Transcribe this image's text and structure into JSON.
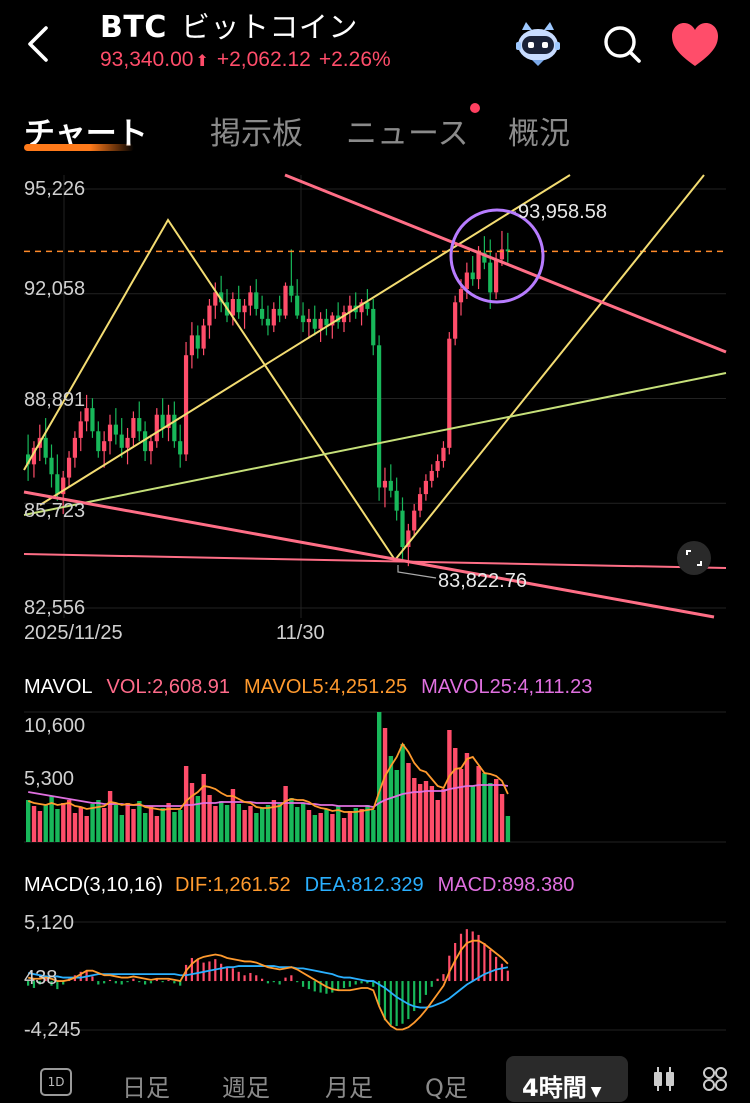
{
  "header": {
    "symbol": "BTC",
    "name": "ビットコイン",
    "price": "93,340.00",
    "change": "+2,062.12",
    "change_pct": "+2.26%"
  },
  "tabs": [
    {
      "label": "チャート",
      "active": true
    },
    {
      "label": "掲示板"
    },
    {
      "label": "ニュース",
      "has_dot": true
    },
    {
      "label": "概況"
    }
  ],
  "chart_data": [
    {
      "type": "candlestick",
      "ylim": [
        82556,
        95226
      ],
      "y_ticks": [
        "95,226",
        "92,058",
        "88,891",
        "85,723",
        "82,556"
      ],
      "x_ticks": [
        "2025/11/25",
        "11/30"
      ],
      "annotations": {
        "high": "93,958.58",
        "low": "83,822.76"
      },
      "current_price": 93340,
      "candles": [
        [
          87200,
          87800,
          86400,
          86900
        ],
        [
          86900,
          87600,
          86500,
          87400
        ],
        [
          87400,
          88100,
          87000,
          87700
        ],
        [
          87700,
          88300,
          86900,
          87100
        ],
        [
          87100,
          87500,
          86200,
          86600
        ],
        [
          86600,
          87200,
          85800,
          86000
        ],
        [
          86000,
          86700,
          85400,
          86500
        ],
        [
          86500,
          87300,
          86200,
          87100
        ],
        [
          87100,
          87900,
          86800,
          87700
        ],
        [
          87700,
          88500,
          87300,
          88200
        ],
        [
          88200,
          89000,
          87900,
          88600
        ],
        [
          88600,
          88900,
          87700,
          87900
        ],
        [
          87900,
          88200,
          87100,
          87300
        ],
        [
          87300,
          87900,
          86800,
          87600
        ],
        [
          87600,
          88400,
          87200,
          88100
        ],
        [
          88100,
          88600,
          87500,
          87800
        ],
        [
          87800,
          88300,
          87100,
          87400
        ],
        [
          87400,
          88000,
          86900,
          87700
        ],
        [
          87700,
          88500,
          87400,
          88300
        ],
        [
          88300,
          88800,
          87600,
          87900
        ],
        [
          87900,
          88200,
          87000,
          87300
        ],
        [
          87300,
          87800,
          86900,
          87600
        ],
        [
          87600,
          88600,
          87400,
          88400
        ],
        [
          88400,
          88900,
          87700,
          88000
        ],
        [
          88000,
          88700,
          87600,
          88400
        ],
        [
          88400,
          88800,
          87400,
          87600
        ],
        [
          87600,
          88100,
          86800,
          87200
        ],
        [
          87200,
          90600,
          87000,
          90200
        ],
        [
          90200,
          91200,
          89800,
          90800
        ],
        [
          90800,
          91100,
          90100,
          90400
        ],
        [
          90400,
          91300,
          90200,
          91100
        ],
        [
          91100,
          91900,
          90700,
          91700
        ],
        [
          91700,
          92400,
          91300,
          92100
        ],
        [
          92100,
          92600,
          91500,
          91800
        ],
        [
          91800,
          92200,
          91200,
          91400
        ],
        [
          91400,
          92100,
          91100,
          91900
        ],
        [
          91900,
          92300,
          91300,
          91500
        ],
        [
          91500,
          91900,
          91000,
          91700
        ],
        [
          91700,
          92300,
          91400,
          92100
        ],
        [
          92100,
          92500,
          91400,
          91600
        ],
        [
          91600,
          92000,
          91100,
          91300
        ],
        [
          91300,
          91700,
          90800,
          91100
        ],
        [
          91100,
          91800,
          90900,
          91600
        ],
        [
          91600,
          92000,
          91200,
          91400
        ],
        [
          91400,
          92400,
          91300,
          92300
        ],
        [
          92300,
          93400,
          91800,
          92000
        ],
        [
          92000,
          92500,
          91300,
          91400
        ],
        [
          91400,
          91800,
          90900,
          91200
        ],
        [
          91200,
          91600,
          90700,
          91300
        ],
        [
          91300,
          91700,
          90800,
          91000
        ],
        [
          91000,
          91500,
          90600,
          91300
        ],
        [
          91300,
          91600,
          90800,
          91100
        ],
        [
          91100,
          91500,
          90700,
          91400
        ],
        [
          91400,
          91800,
          91000,
          91200
        ],
        [
          91200,
          91700,
          90900,
          91500
        ],
        [
          91500,
          92000,
          91200,
          91700
        ],
        [
          91700,
          92100,
          91300,
          91500
        ],
        [
          91500,
          91900,
          91100,
          91800
        ],
        [
          91800,
          92200,
          91400,
          91600
        ],
        [
          91600,
          91900,
          90200,
          90500
        ],
        [
          90500,
          90800,
          85800,
          86200
        ],
        [
          86200,
          86800,
          85600,
          86400
        ],
        [
          86400,
          86900,
          85900,
          86100
        ],
        [
          86100,
          86500,
          85200,
          85500
        ],
        [
          85500,
          85900,
          84000,
          84400
        ],
        [
          84400,
          85100,
          83822,
          84900
        ],
        [
          84900,
          85700,
          84700,
          85500
        ],
        [
          85500,
          86200,
          85300,
          86000
        ],
        [
          86000,
          86600,
          85800,
          86400
        ],
        [
          86400,
          86900,
          86200,
          86700
        ],
        [
          86700,
          87200,
          86500,
          87000
        ],
        [
          87000,
          87600,
          86800,
          87400
        ],
        [
          87400,
          90900,
          87200,
          90700
        ],
        [
          90700,
          92000,
          90500,
          91800
        ],
        [
          91800,
          92500,
          91400,
          92200
        ],
        [
          92200,
          93000,
          91900,
          92700
        ],
        [
          92700,
          93200,
          92300,
          92500
        ],
        [
          92500,
          93500,
          92200,
          93300
        ],
        [
          93300,
          93800,
          92800,
          93000
        ],
        [
          93000,
          93700,
          91600,
          92100
        ],
        [
          92100,
          93300,
          91900,
          93100
        ],
        [
          93100,
          93958,
          92900,
          93400
        ],
        [
          93400,
          93900,
          93000,
          93340
        ]
      ]
    },
    {
      "type": "bar",
      "title": "MAVOL",
      "series": [
        {
          "name": "VOL",
          "value": "2,608.91",
          "color": "#ff6b8a"
        },
        {
          "name": "MAVOL5",
          "value": "4,251.25",
          "color": "#ff9a2e"
        },
        {
          "name": "MAVOL25",
          "value": "4,111.23",
          "color": "#e070e0"
        }
      ],
      "y_ticks": [
        "10,600",
        "5,300"
      ],
      "ylim": [
        0,
        13000
      ],
      "values": [
        4200,
        3600,
        3100,
        3800,
        4600,
        3300,
        3900,
        4200,
        2900,
        3500,
        2600,
        3800,
        4200,
        3400,
        5100,
        3700,
        2700,
        3900,
        3300,
        4100,
        2900,
        3600,
        2600,
        3400,
        3900,
        3000,
        3200,
        7600,
        5900,
        4600,
        6800,
        4700,
        3600,
        4100,
        3700,
        5300,
        3800,
        3200,
        3600,
        2900,
        3400,
        3700,
        4200,
        3800,
        5600,
        4400,
        3500,
        3900,
        3200,
        2700,
        2900,
        3300,
        2800,
        3600,
        2400,
        3100,
        3400,
        3300,
        3700,
        3200,
        13000,
        11400,
        8600,
        7200,
        9800,
        7900,
        6400,
        5800,
        6100,
        5600,
        4200,
        5300,
        11200,
        9400,
        7300,
        8900,
        5600,
        7600,
        6900,
        5900,
        6300,
        4800,
        2600
      ],
      "mavol5": [
        4100,
        3900,
        3800,
        3700,
        3900,
        3700,
        3800,
        3900,
        3600,
        3500,
        3300,
        3400,
        3500,
        3600,
        4000,
        3900,
        3700,
        3800,
        3700,
        3800,
        3500,
        3400,
        3300,
        3200,
        3300,
        3300,
        3300,
        4100,
        4600,
        5000,
        5600,
        5500,
        5300,
        4900,
        4600,
        4600,
        4300,
        4000,
        3900,
        3500,
        3400,
        3400,
        3500,
        3600,
        4100,
        4300,
        4200,
        4200,
        4000,
        3600,
        3400,
        3300,
        3100,
        3200,
        3000,
        3000,
        3000,
        3100,
        3200,
        3300,
        5000,
        6600,
        7600,
        8500,
        9800,
        9000,
        7900,
        7200,
        7000,
        6300,
        5600,
        5400,
        6600,
        7300,
        7400,
        8300,
        8500,
        7700,
        6900,
        6800,
        6600,
        6100,
        4800
      ],
      "mavol25": [
        5000,
        4900,
        4800,
        4700,
        4600,
        4500,
        4400,
        4300,
        4200,
        4100,
        4000,
        3900,
        3900,
        3800,
        3800,
        3800,
        3800,
        3700,
        3700,
        3700,
        3600,
        3600,
        3600,
        3600,
        3600,
        3600,
        3600,
        3700,
        3700,
        3800,
        3900,
        3900,
        3900,
        4000,
        4000,
        4000,
        4000,
        4000,
        4000,
        3900,
        3900,
        3900,
        3900,
        3900,
        3900,
        3900,
        3900,
        3900,
        3800,
        3800,
        3700,
        3700,
        3700,
        3600,
        3600,
        3600,
        3600,
        3600,
        3600,
        3500,
        3900,
        4200,
        4400,
        4600,
        4800,
        4900,
        5000,
        5000,
        5100,
        5100,
        5100,
        5100,
        5300,
        5400,
        5500,
        5600,
        5600,
        5700,
        5700,
        5700,
        5700,
        5700,
        5600
      ]
    },
    {
      "type": "bar",
      "title": "MACD(3,10,16)",
      "series": [
        {
          "name": "DIF",
          "value": "1,261.52",
          "color": "#ff9a2e"
        },
        {
          "name": "DEA",
          "value": "812.329",
          "color": "#2ab0ff"
        },
        {
          "name": "MACD",
          "value": "898.380",
          "color": "#e070e0"
        }
      ],
      "y_ticks": [
        "5,120",
        "438",
        "-4,245"
      ],
      "ylim": [
        -4245,
        5120
      ],
      "values": [
        -400,
        -600,
        -300,
        200,
        -400,
        -700,
        -300,
        200,
        500,
        800,
        900,
        400,
        -300,
        -200,
        100,
        -200,
        -300,
        -100,
        200,
        -100,
        -300,
        -200,
        200,
        -100,
        100,
        -200,
        -400,
        1400,
        2000,
        1900,
        1600,
        1700,
        1900,
        1500,
        1200,
        1100,
        800,
        500,
        700,
        500,
        200,
        -200,
        -100,
        -300,
        300,
        500,
        -100,
        -500,
        -700,
        -900,
        -1000,
        -1100,
        -1000,
        -800,
        -600,
        -500,
        -300,
        -200,
        -200,
        -500,
        -2100,
        -3400,
        -3800,
        -3900,
        -3700,
        -3300,
        -2600,
        -1900,
        -1200,
        -500,
        200,
        600,
        2200,
        3300,
        4100,
        4500,
        4300,
        4000,
        3300,
        2700,
        2100,
        1500,
        900
      ],
      "dif": [
        300,
        200,
        200,
        300,
        200,
        0,
        0,
        100,
        300,
        600,
        900,
        900,
        700,
        500,
        500,
        400,
        300,
        300,
        400,
        300,
        200,
        100,
        200,
        200,
        200,
        100,
        0,
        900,
        1500,
        1900,
        2100,
        2200,
        2300,
        2200,
        2000,
        1900,
        1800,
        1700,
        1700,
        1600,
        1400,
        1200,
        1100,
        1000,
        1100,
        1200,
        1000,
        700,
        400,
        100,
        -200,
        -500,
        -700,
        -800,
        -800,
        -800,
        -700,
        -600,
        -600,
        -800,
        -2200,
        -3300,
        -3900,
        -4200,
        -4200,
        -4000,
        -3600,
        -3100,
        -2500,
        -1800,
        -1100,
        -400,
        800,
        1800,
        2700,
        3300,
        3500,
        3500,
        3200,
        2800,
        2400,
        2000,
        1500
      ],
      "dea": [
        700,
        600,
        500,
        400,
        400,
        400,
        300,
        300,
        300,
        300,
        400,
        500,
        600,
        600,
        600,
        600,
        600,
        600,
        600,
        600,
        600,
        600,
        600,
        600,
        600,
        600,
        500,
        500,
        600,
        700,
        800,
        900,
        1000,
        1100,
        1200,
        1200,
        1300,
        1300,
        1300,
        1300,
        1300,
        1300,
        1300,
        1200,
        1200,
        1200,
        1100,
        1100,
        1000,
        900,
        800,
        700,
        600,
        400,
        300,
        300,
        200,
        100,
        0,
        0,
        -300,
        -600,
        -1000,
        -1400,
        -1700,
        -2000,
        -2200,
        -2300,
        -2300,
        -2200,
        -2000,
        -1800,
        -1500,
        -1100,
        -700,
        -300,
        0,
        300,
        600,
        800,
        1000,
        1100,
        1200
      ]
    }
  ],
  "bottom_tabs": [
    "日足",
    "週足",
    "月足",
    "Q足"
  ],
  "bottom_active": "4時間",
  "bottom_icon_label": "1D"
}
